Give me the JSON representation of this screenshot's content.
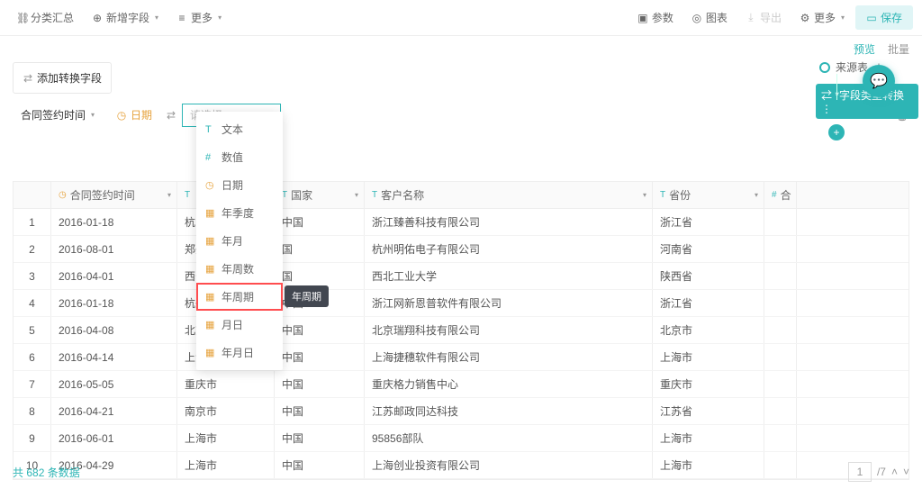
{
  "topbar": {
    "summary": "分类汇总",
    "add_field": "新增字段",
    "more": "更多",
    "params": "参数",
    "chart": "图表",
    "export": "导出",
    "more2": "更多",
    "save": "保存"
  },
  "subbar": {
    "preview": "预览",
    "batch": "批量"
  },
  "panel": {
    "add_convert": "添加转换字段"
  },
  "config": {
    "field_label": "合同签约时间",
    "date_label": "日期",
    "select_placeholder": "请选择"
  },
  "dropdown": {
    "items": [
      {
        "icon": "T",
        "cls": "t",
        "label": "文本"
      },
      {
        "icon": "#",
        "cls": "n",
        "label": "数值"
      },
      {
        "icon": "◷",
        "cls": "",
        "label": "日期"
      },
      {
        "icon": "▦",
        "cls": "",
        "label": "年季度"
      },
      {
        "icon": "▦",
        "cls": "",
        "label": "年月"
      },
      {
        "icon": "▦",
        "cls": "",
        "label": "年周数"
      },
      {
        "icon": "▦",
        "cls": "",
        "label": "年周期",
        "hl": true
      },
      {
        "icon": "▦",
        "cls": "",
        "label": "月日"
      },
      {
        "icon": "▦",
        "cls": "",
        "label": "年月日"
      }
    ]
  },
  "tooltip": "年周期",
  "table": {
    "headers": {
      "c1": "合同签约时间",
      "c1_ico": "◷",
      "c2": "T",
      "c2_lbl": "",
      "c3": "国家",
      "c3_ico": "T",
      "c4": "客户名称",
      "c4_ico": "T",
      "c5": "省份",
      "c5_ico": "T",
      "c6": "合",
      "c6_ico": "#"
    },
    "rows": [
      {
        "n": "1",
        "d": "2016-01-18",
        "city": "杭…",
        "country": "中国",
        "cust": "浙江臻善科技有限公司",
        "prov": "浙江省"
      },
      {
        "n": "2",
        "d": "2016-08-01",
        "city": "郑州",
        "country": "国",
        "cust": "杭州明佑电子有限公司",
        "prov": "河南省"
      },
      {
        "n": "3",
        "d": "2016-04-01",
        "city": "西安",
        "country": "国",
        "cust": "西北工业大学",
        "prov": "陕西省"
      },
      {
        "n": "4",
        "d": "2016-01-18",
        "city": "杭州",
        "country": "中国",
        "cust": "浙江网新恩普软件有限公司",
        "prov": "浙江省"
      },
      {
        "n": "5",
        "d": "2016-04-08",
        "city": "北京",
        "country": "中国",
        "cust": "北京瑞翔科技有限公司",
        "prov": "北京市"
      },
      {
        "n": "6",
        "d": "2016-04-14",
        "city": "上海市",
        "country": "中国",
        "cust": "上海捷穗软件有限公司",
        "prov": "上海市"
      },
      {
        "n": "7",
        "d": "2016-05-05",
        "city": "重庆市",
        "country": "中国",
        "cust": "重庆格力销售中心",
        "prov": "重庆市"
      },
      {
        "n": "8",
        "d": "2016-04-21",
        "city": "南京市",
        "country": "中国",
        "cust": "江苏邮政同达科技",
        "prov": "江苏省"
      },
      {
        "n": "9",
        "d": "2016-06-01",
        "city": "上海市",
        "country": "中国",
        "cust": "95856部队",
        "prov": "上海市"
      },
      {
        "n": "10",
        "d": "2016-04-29",
        "city": "上海市",
        "country": "中国",
        "cust": "上海创业投资有限公司",
        "prov": "上海市"
      }
    ]
  },
  "footer": {
    "total_prefix": "共 ",
    "total_count": "682",
    "total_suffix": " 条数据",
    "page": "1",
    "total_pages": "/7"
  },
  "sidebar": {
    "source": "来源表",
    "convert": "*字段类型转换"
  },
  "icons": {
    "tree": "⛓",
    "plus_field": "⊕",
    "list": "≡",
    "param": "▣",
    "chart_ring": "◎",
    "export": "⤓",
    "gear": "⚙",
    "save": "▭",
    "shuffle": "✕",
    "plus": "+",
    "chat": "💬"
  }
}
